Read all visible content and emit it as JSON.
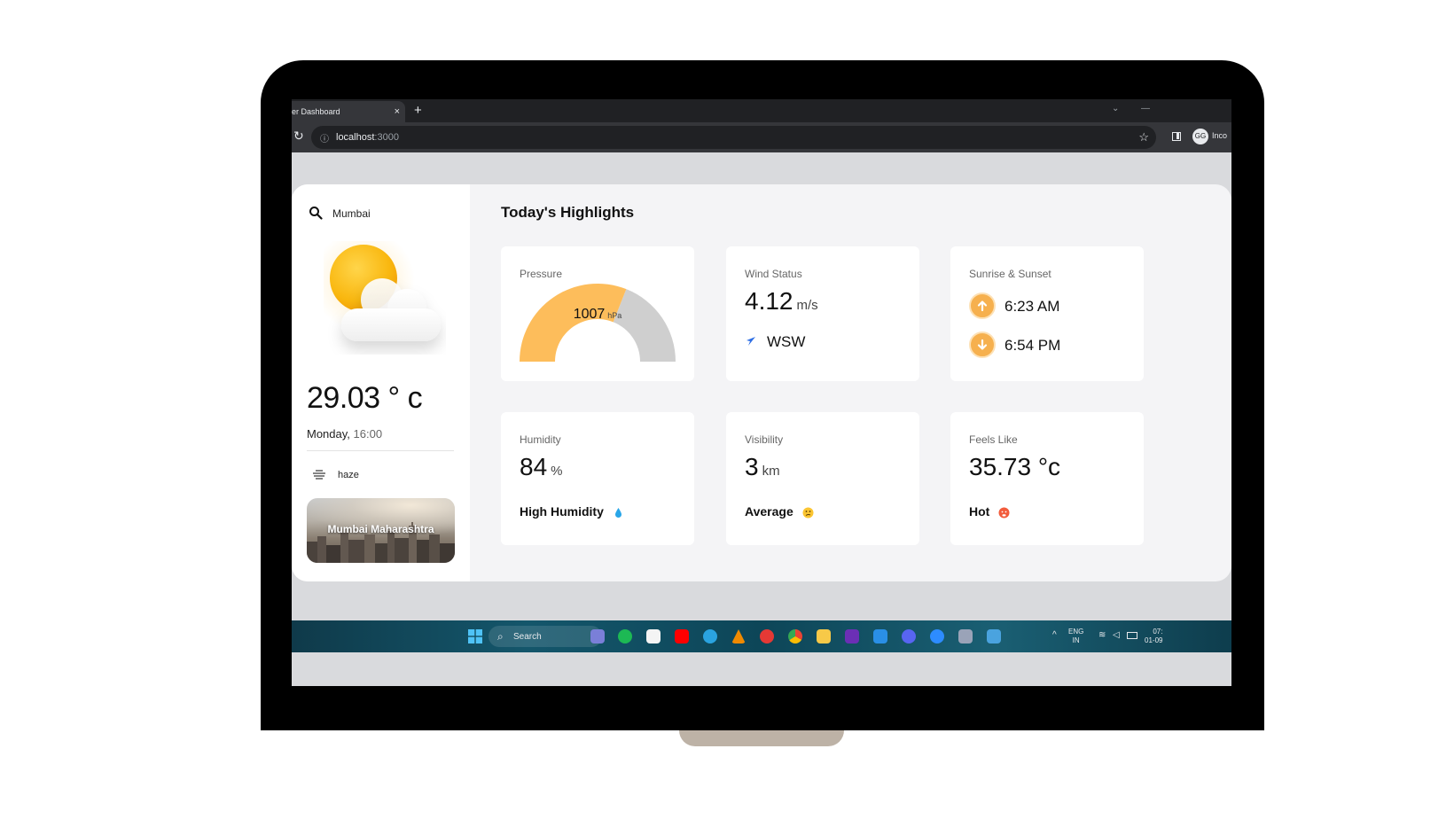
{
  "browser": {
    "tab_title": "er Dashboard",
    "tab_close": "×",
    "new_tab": "+",
    "address": "localhost",
    "address_port": ":3000",
    "profile_label": "Inco",
    "profile_initials": "GG"
  },
  "sidebar": {
    "search_value": "Mumbai",
    "temperature": "29.03 ° c",
    "day": "Monday,",
    "time": "16:00",
    "condition": "haze",
    "city_card_label": "Mumbai Maharashtra"
  },
  "highlights": {
    "title": "Today's Highlights",
    "pressure": {
      "title": "Pressure",
      "value": "1007",
      "unit": "hPa",
      "fill_fraction": 0.62
    },
    "wind": {
      "title": "Wind Status",
      "value": "4.12",
      "unit": "m/s",
      "direction": "WSW"
    },
    "sun": {
      "title": "Sunrise & Sunset",
      "sunrise": "6:23 AM",
      "sunset": "6:54 PM"
    },
    "humidity": {
      "title": "Humidity",
      "value": "84",
      "unit": "%",
      "status": "High Humidity"
    },
    "visibility": {
      "title": "Visibility",
      "value": "3",
      "unit": "km",
      "status": "Average"
    },
    "feels_like": {
      "title": "Feels Like",
      "value": "35.73 °c",
      "status": "Hot"
    }
  },
  "taskbar": {
    "search_label": "Search",
    "lang_top": "ENG",
    "lang_bottom": "IN",
    "clock_top": "07:",
    "clock_bottom": "01-09"
  },
  "colors": {
    "accent": "#f6b04e",
    "gauge_fill": "#fdbd5b",
    "gauge_rest": "#cfcfcf",
    "panel_bg": "#f4f4f6",
    "screen_bg": "#d9dadd"
  }
}
